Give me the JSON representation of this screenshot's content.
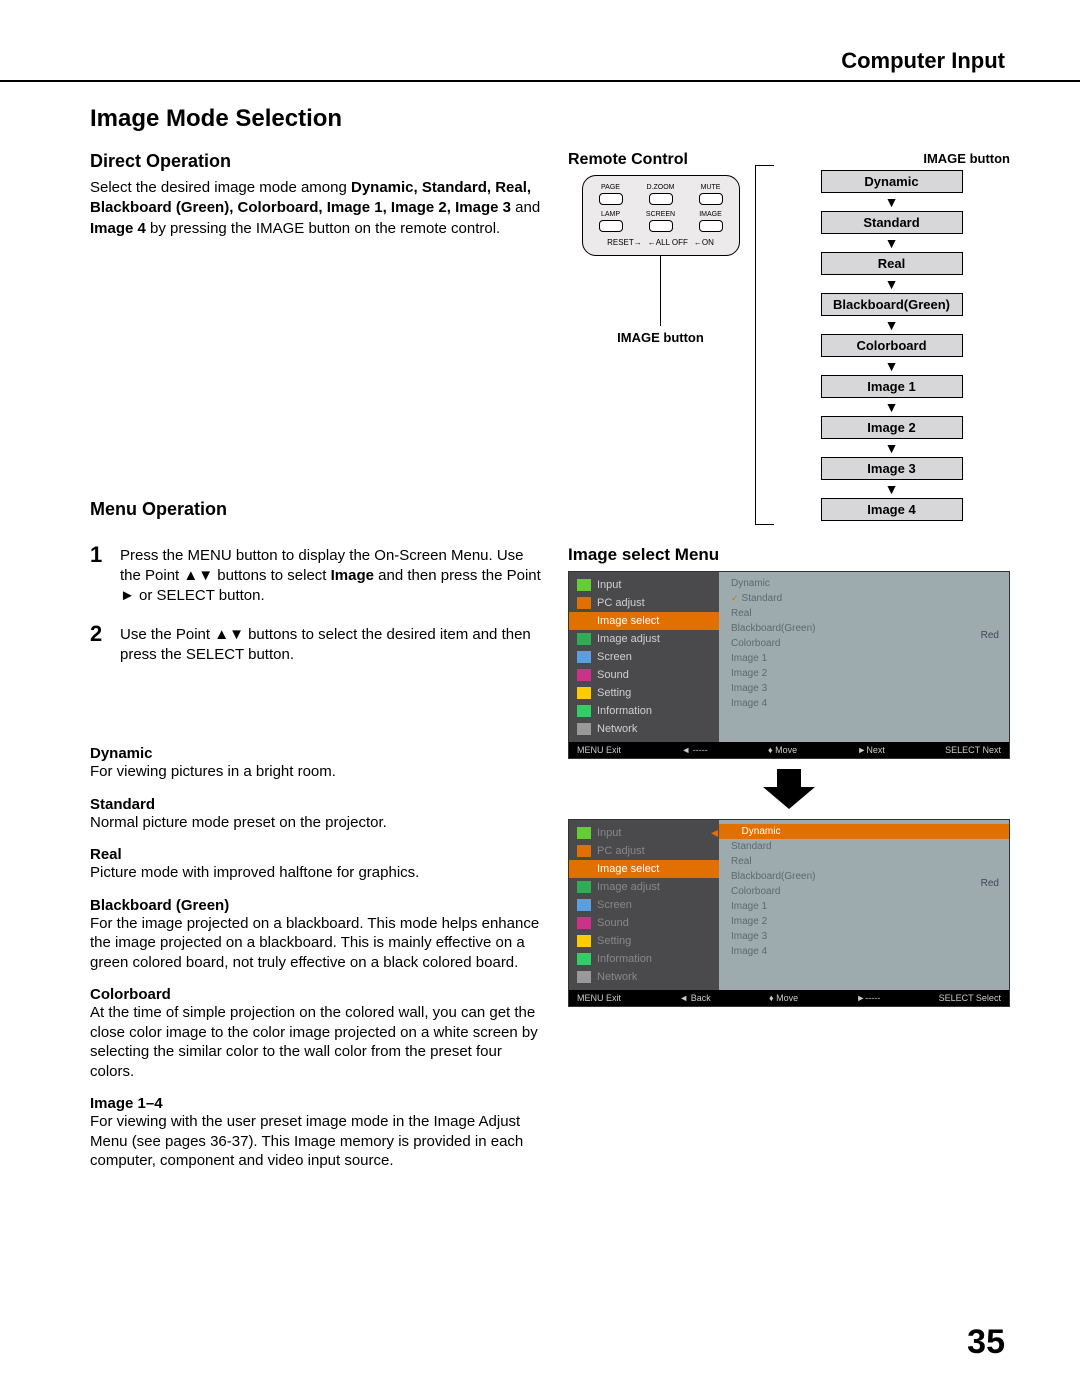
{
  "header": "Computer Input",
  "title": "Image Mode Selection",
  "direct": {
    "heading": "Direct Operation",
    "intro_a": "Select the desired image mode among ",
    "intro_bold": "Dynamic, Standard, Real, Blackboard (Green), Colorboard, Image 1, Image 2, Image 3",
    "intro_mid": " and ",
    "intro_bold2": "Image 4",
    "intro_b": " by pressing the IMAGE button on the remote control."
  },
  "menu": {
    "heading": "Menu Operation",
    "steps": [
      {
        "num": "1",
        "a": "Press the MENU button to display the On-Screen Menu. Use the Point ▲▼ buttons to select ",
        "bold": "Image",
        "b": " and then press the Point ► or SELECT button."
      },
      {
        "num": "2",
        "a": "Use the Point ▲▼ buttons to select the desired item and then press the SELECT button.",
        "bold": "",
        "b": ""
      }
    ]
  },
  "modes": [
    {
      "name": "Dynamic",
      "desc": "For viewing pictures in a bright room."
    },
    {
      "name": "Standard",
      "desc": "Normal picture mode preset on the projector."
    },
    {
      "name": "Real",
      "desc": "Picture mode with improved halftone for graphics."
    },
    {
      "name": "Blackboard (Green)",
      "desc": "For the image projected on a blackboard.\nThis mode helps enhance the image projected on a blackboard. This is mainly effective on a green colored board, not truly effective on a black colored board."
    },
    {
      "name": "Colorboard",
      "desc": "At the time of simple projection on the colored wall, you can get the close color image to the color image projected on a white screen by selecting the similar color to the wall color from the preset four colors."
    },
    {
      "name": "Image 1–4",
      "desc": "For viewing with the user preset image mode in the Image Adjust Menu (see pages 36-37). This Image memory is provided in each computer, component and video input source."
    }
  ],
  "remote": {
    "label": "Remote Control",
    "row1": [
      "PAGE",
      "D.ZOOM",
      "MUTE"
    ],
    "row2": [
      "LAMP",
      "SCREEN",
      "IMAGE"
    ],
    "reset": [
      "RESET→",
      "←ALL OFF",
      "←ON"
    ],
    "caption": "IMAGE button"
  },
  "flow": {
    "title": "IMAGE button",
    "nodes": [
      "Dynamic",
      "Standard",
      "Real",
      "Blackboard(Green)",
      "Colorboard",
      "Image 1",
      "Image 2",
      "Image 3",
      "Image 4"
    ]
  },
  "osd": {
    "title": "Image select Menu",
    "left_items": [
      "Input",
      "PC adjust",
      "Image select",
      "Image adjust",
      "Screen",
      "Sound",
      "Setting",
      "Information",
      "Network"
    ],
    "icon_colors": [
      "#66cc33",
      "#e07000",
      "#e07000",
      "#33aa55",
      "#5aa0e0",
      "#cc3388",
      "#ffcc00",
      "#33cc66",
      "#999999"
    ],
    "right_items": [
      "Dynamic",
      "Standard",
      "Real",
      "Blackboard(Green)",
      "Colorboard",
      "Image 1",
      "Image 2",
      "Image 3",
      "Image 4"
    ],
    "red_label": "Red",
    "foot1": {
      "exit": "MENU Exit",
      "back": "◄ -----",
      "move": "♦ Move",
      "next": "►Next",
      "sel": "SELECT  Next"
    },
    "foot2": {
      "exit": "MENU Exit",
      "back": "◄ Back",
      "move": "♦ Move",
      "next": "►-----",
      "sel": "SELECT  Select"
    }
  },
  "page_number": "35"
}
